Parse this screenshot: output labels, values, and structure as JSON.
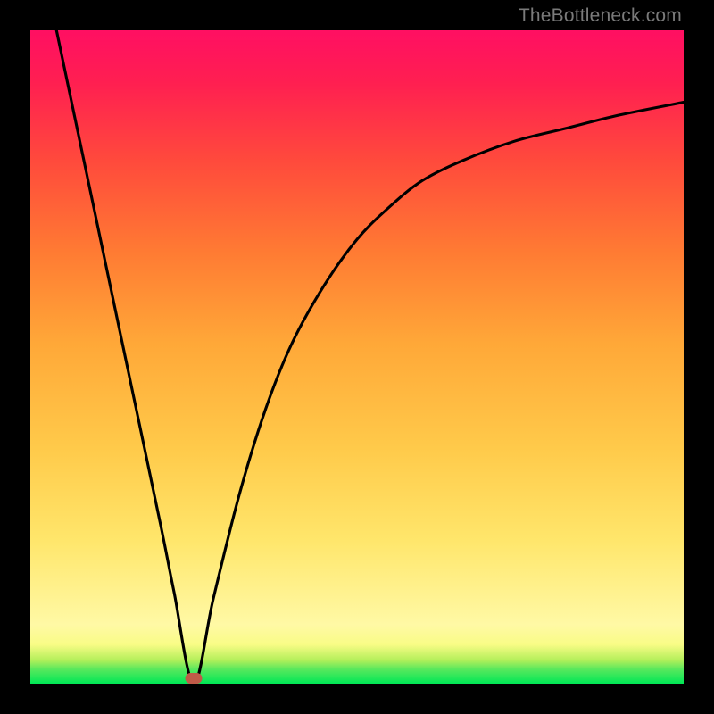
{
  "watermark": "TheBottleneck.com",
  "colors": {
    "frame": "#000000",
    "curve": "#000000",
    "marker": "#c05a48",
    "gradient_top": "#ff0f62",
    "gradient_bottom": "#00e756"
  },
  "chart_data": {
    "type": "line",
    "title": "",
    "xlabel": "",
    "ylabel": "",
    "xlim": [
      0,
      100
    ],
    "ylim": [
      0,
      100
    ],
    "grid": false,
    "legend": false,
    "series": [
      {
        "name": "bottleneck-curve",
        "x": [
          4,
          8,
          12,
          16,
          20,
          22,
          25,
          28,
          32,
          36,
          40,
          45,
          50,
          55,
          60,
          66,
          74,
          82,
          90,
          100
        ],
        "y": [
          100,
          81,
          62,
          43,
          24,
          14,
          0,
          13,
          29,
          42,
          52,
          61,
          68,
          73,
          77,
          80,
          83,
          85,
          87,
          89
        ]
      }
    ],
    "annotations": [
      {
        "name": "minimum-marker",
        "x": 25,
        "y": 0.8
      }
    ]
  }
}
